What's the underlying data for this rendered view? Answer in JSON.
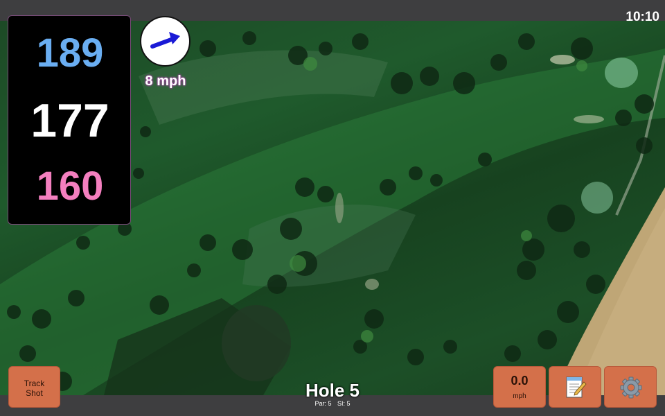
{
  "status": {
    "time": "10:10"
  },
  "distances": {
    "back": "189",
    "middle": "177",
    "front": "160"
  },
  "wind": {
    "speed_label": "8 mph",
    "arrow_icon": "wind-direction-arrow-icon"
  },
  "hole": {
    "title": "Hole 5",
    "par": "Par: 5",
    "si": "SI: 5"
  },
  "buttons": {
    "track_shot_line1": "Track",
    "track_shot_line2": "Shot",
    "speed_value": "0.0",
    "speed_unit": "mph",
    "notes_icon": "notepad-icon",
    "settings_icon": "gear-icon"
  },
  "colors": {
    "back_distance": "#6aaef2",
    "middle_distance": "#ffffff",
    "front_distance": "#f47fbf",
    "button_bg": "#d4704a",
    "bar_bg": "#3e3e40"
  }
}
